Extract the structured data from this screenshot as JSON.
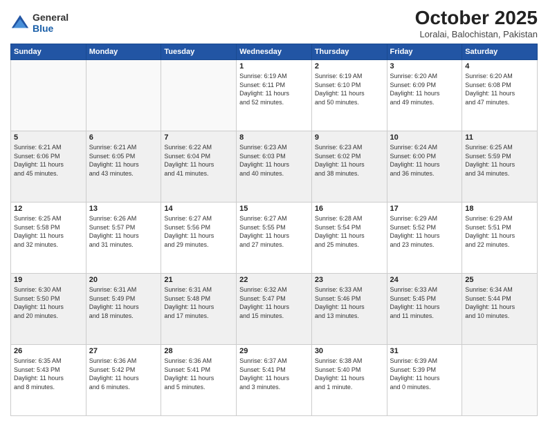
{
  "header": {
    "logo_general": "General",
    "logo_blue": "Blue",
    "month": "October 2025",
    "location": "Loralai, Balochistan, Pakistan"
  },
  "weekdays": [
    "Sunday",
    "Monday",
    "Tuesday",
    "Wednesday",
    "Thursday",
    "Friday",
    "Saturday"
  ],
  "weeks": [
    [
      {
        "day": "",
        "info": ""
      },
      {
        "day": "",
        "info": ""
      },
      {
        "day": "",
        "info": ""
      },
      {
        "day": "1",
        "info": "Sunrise: 6:19 AM\nSunset: 6:11 PM\nDaylight: 11 hours\nand 52 minutes."
      },
      {
        "day": "2",
        "info": "Sunrise: 6:19 AM\nSunset: 6:10 PM\nDaylight: 11 hours\nand 50 minutes."
      },
      {
        "day": "3",
        "info": "Sunrise: 6:20 AM\nSunset: 6:09 PM\nDaylight: 11 hours\nand 49 minutes."
      },
      {
        "day": "4",
        "info": "Sunrise: 6:20 AM\nSunset: 6:08 PM\nDaylight: 11 hours\nand 47 minutes."
      }
    ],
    [
      {
        "day": "5",
        "info": "Sunrise: 6:21 AM\nSunset: 6:06 PM\nDaylight: 11 hours\nand 45 minutes."
      },
      {
        "day": "6",
        "info": "Sunrise: 6:21 AM\nSunset: 6:05 PM\nDaylight: 11 hours\nand 43 minutes."
      },
      {
        "day": "7",
        "info": "Sunrise: 6:22 AM\nSunset: 6:04 PM\nDaylight: 11 hours\nand 41 minutes."
      },
      {
        "day": "8",
        "info": "Sunrise: 6:23 AM\nSunset: 6:03 PM\nDaylight: 11 hours\nand 40 minutes."
      },
      {
        "day": "9",
        "info": "Sunrise: 6:23 AM\nSunset: 6:02 PM\nDaylight: 11 hours\nand 38 minutes."
      },
      {
        "day": "10",
        "info": "Sunrise: 6:24 AM\nSunset: 6:00 PM\nDaylight: 11 hours\nand 36 minutes."
      },
      {
        "day": "11",
        "info": "Sunrise: 6:25 AM\nSunset: 5:59 PM\nDaylight: 11 hours\nand 34 minutes."
      }
    ],
    [
      {
        "day": "12",
        "info": "Sunrise: 6:25 AM\nSunset: 5:58 PM\nDaylight: 11 hours\nand 32 minutes."
      },
      {
        "day": "13",
        "info": "Sunrise: 6:26 AM\nSunset: 5:57 PM\nDaylight: 11 hours\nand 31 minutes."
      },
      {
        "day": "14",
        "info": "Sunrise: 6:27 AM\nSunset: 5:56 PM\nDaylight: 11 hours\nand 29 minutes."
      },
      {
        "day": "15",
        "info": "Sunrise: 6:27 AM\nSunset: 5:55 PM\nDaylight: 11 hours\nand 27 minutes."
      },
      {
        "day": "16",
        "info": "Sunrise: 6:28 AM\nSunset: 5:54 PM\nDaylight: 11 hours\nand 25 minutes."
      },
      {
        "day": "17",
        "info": "Sunrise: 6:29 AM\nSunset: 5:52 PM\nDaylight: 11 hours\nand 23 minutes."
      },
      {
        "day": "18",
        "info": "Sunrise: 6:29 AM\nSunset: 5:51 PM\nDaylight: 11 hours\nand 22 minutes."
      }
    ],
    [
      {
        "day": "19",
        "info": "Sunrise: 6:30 AM\nSunset: 5:50 PM\nDaylight: 11 hours\nand 20 minutes."
      },
      {
        "day": "20",
        "info": "Sunrise: 6:31 AM\nSunset: 5:49 PM\nDaylight: 11 hours\nand 18 minutes."
      },
      {
        "day": "21",
        "info": "Sunrise: 6:31 AM\nSunset: 5:48 PM\nDaylight: 11 hours\nand 17 minutes."
      },
      {
        "day": "22",
        "info": "Sunrise: 6:32 AM\nSunset: 5:47 PM\nDaylight: 11 hours\nand 15 minutes."
      },
      {
        "day": "23",
        "info": "Sunrise: 6:33 AM\nSunset: 5:46 PM\nDaylight: 11 hours\nand 13 minutes."
      },
      {
        "day": "24",
        "info": "Sunrise: 6:33 AM\nSunset: 5:45 PM\nDaylight: 11 hours\nand 11 minutes."
      },
      {
        "day": "25",
        "info": "Sunrise: 6:34 AM\nSunset: 5:44 PM\nDaylight: 11 hours\nand 10 minutes."
      }
    ],
    [
      {
        "day": "26",
        "info": "Sunrise: 6:35 AM\nSunset: 5:43 PM\nDaylight: 11 hours\nand 8 minutes."
      },
      {
        "day": "27",
        "info": "Sunrise: 6:36 AM\nSunset: 5:42 PM\nDaylight: 11 hours\nand 6 minutes."
      },
      {
        "day": "28",
        "info": "Sunrise: 6:36 AM\nSunset: 5:41 PM\nDaylight: 11 hours\nand 5 minutes."
      },
      {
        "day": "29",
        "info": "Sunrise: 6:37 AM\nSunset: 5:41 PM\nDaylight: 11 hours\nand 3 minutes."
      },
      {
        "day": "30",
        "info": "Sunrise: 6:38 AM\nSunset: 5:40 PM\nDaylight: 11 hours\nand 1 minute."
      },
      {
        "day": "31",
        "info": "Sunrise: 6:39 AM\nSunset: 5:39 PM\nDaylight: 11 hours\nand 0 minutes."
      },
      {
        "day": "",
        "info": ""
      }
    ]
  ]
}
